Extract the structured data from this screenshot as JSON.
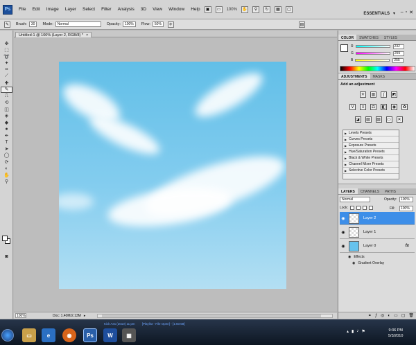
{
  "menubar": {
    "logo": "Ps",
    "items": [
      "File",
      "Edit",
      "Image",
      "Layer",
      "Select",
      "Filter",
      "Analysis",
      "3D",
      "View",
      "Window",
      "Help"
    ],
    "zoom": "100%",
    "workspace": "ESSENTIALS",
    "window_controls": [
      "–",
      "▫",
      "✕"
    ]
  },
  "options": {
    "brush_label": "Brush:",
    "brush_size": "30",
    "mode_label": "Mode:",
    "mode_value": "Normal",
    "opacity_label": "Opacity:",
    "opacity_value": "100%",
    "flow_label": "Flow:",
    "flow_value": "50%"
  },
  "document": {
    "tab_title": "Untitled-1 @ 100% (Layer 2, RGB/8) *",
    "tab_close": "×"
  },
  "status": {
    "zoom": "100%",
    "doc": "Doc: 1.40M/2.13M"
  },
  "color_panel": {
    "tabs": [
      "COLOR",
      "SWATCHES",
      "STYLES"
    ],
    "channels": [
      {
        "label": "R",
        "value": "232",
        "gradient": "linear-gradient(90deg,#00ffff,#ffffff)"
      },
      {
        "label": "G",
        "value": "255",
        "gradient": "linear-gradient(90deg,#ff00ff,#ffffff)"
      },
      {
        "label": "B",
        "value": "255",
        "gradient": "linear-gradient(90deg,#ffff00,#ffffff)"
      }
    ]
  },
  "adjustments": {
    "tabs": [
      "ADJUSTMENTS",
      "MASKS"
    ],
    "title": "Add an adjustment",
    "presets": [
      "Levels Presets",
      "Curves Presets",
      "Exposure Presets",
      "Hue/Saturation Presets",
      "Black & White Presets",
      "Channel Mixer Presets",
      "Selective Color Presets"
    ]
  },
  "layers": {
    "tabs": [
      "LAYERS",
      "CHANNELS",
      "PATHS"
    ],
    "blend_mode": "Normal",
    "opacity_label": "Opacity:",
    "opacity_value": "100%",
    "lock_label": "Lock:",
    "fill_label": "Fill:",
    "fill_value": "100%",
    "rows": [
      {
        "name": "Layer 2"
      },
      {
        "name": "Layer 1"
      },
      {
        "name": "Layer 0",
        "fx": "fx"
      }
    ],
    "effects_label": "Effects",
    "gradient_overlay_label": "Gradient Overlay"
  },
  "taskbar": {
    "band_text": [
      "Kick Ass (2010) 11 pm",
      "[Playlist - File Open] - [1:50:58]"
    ],
    "clock_time": "9:36 PM",
    "clock_date": "5/3/2010"
  }
}
